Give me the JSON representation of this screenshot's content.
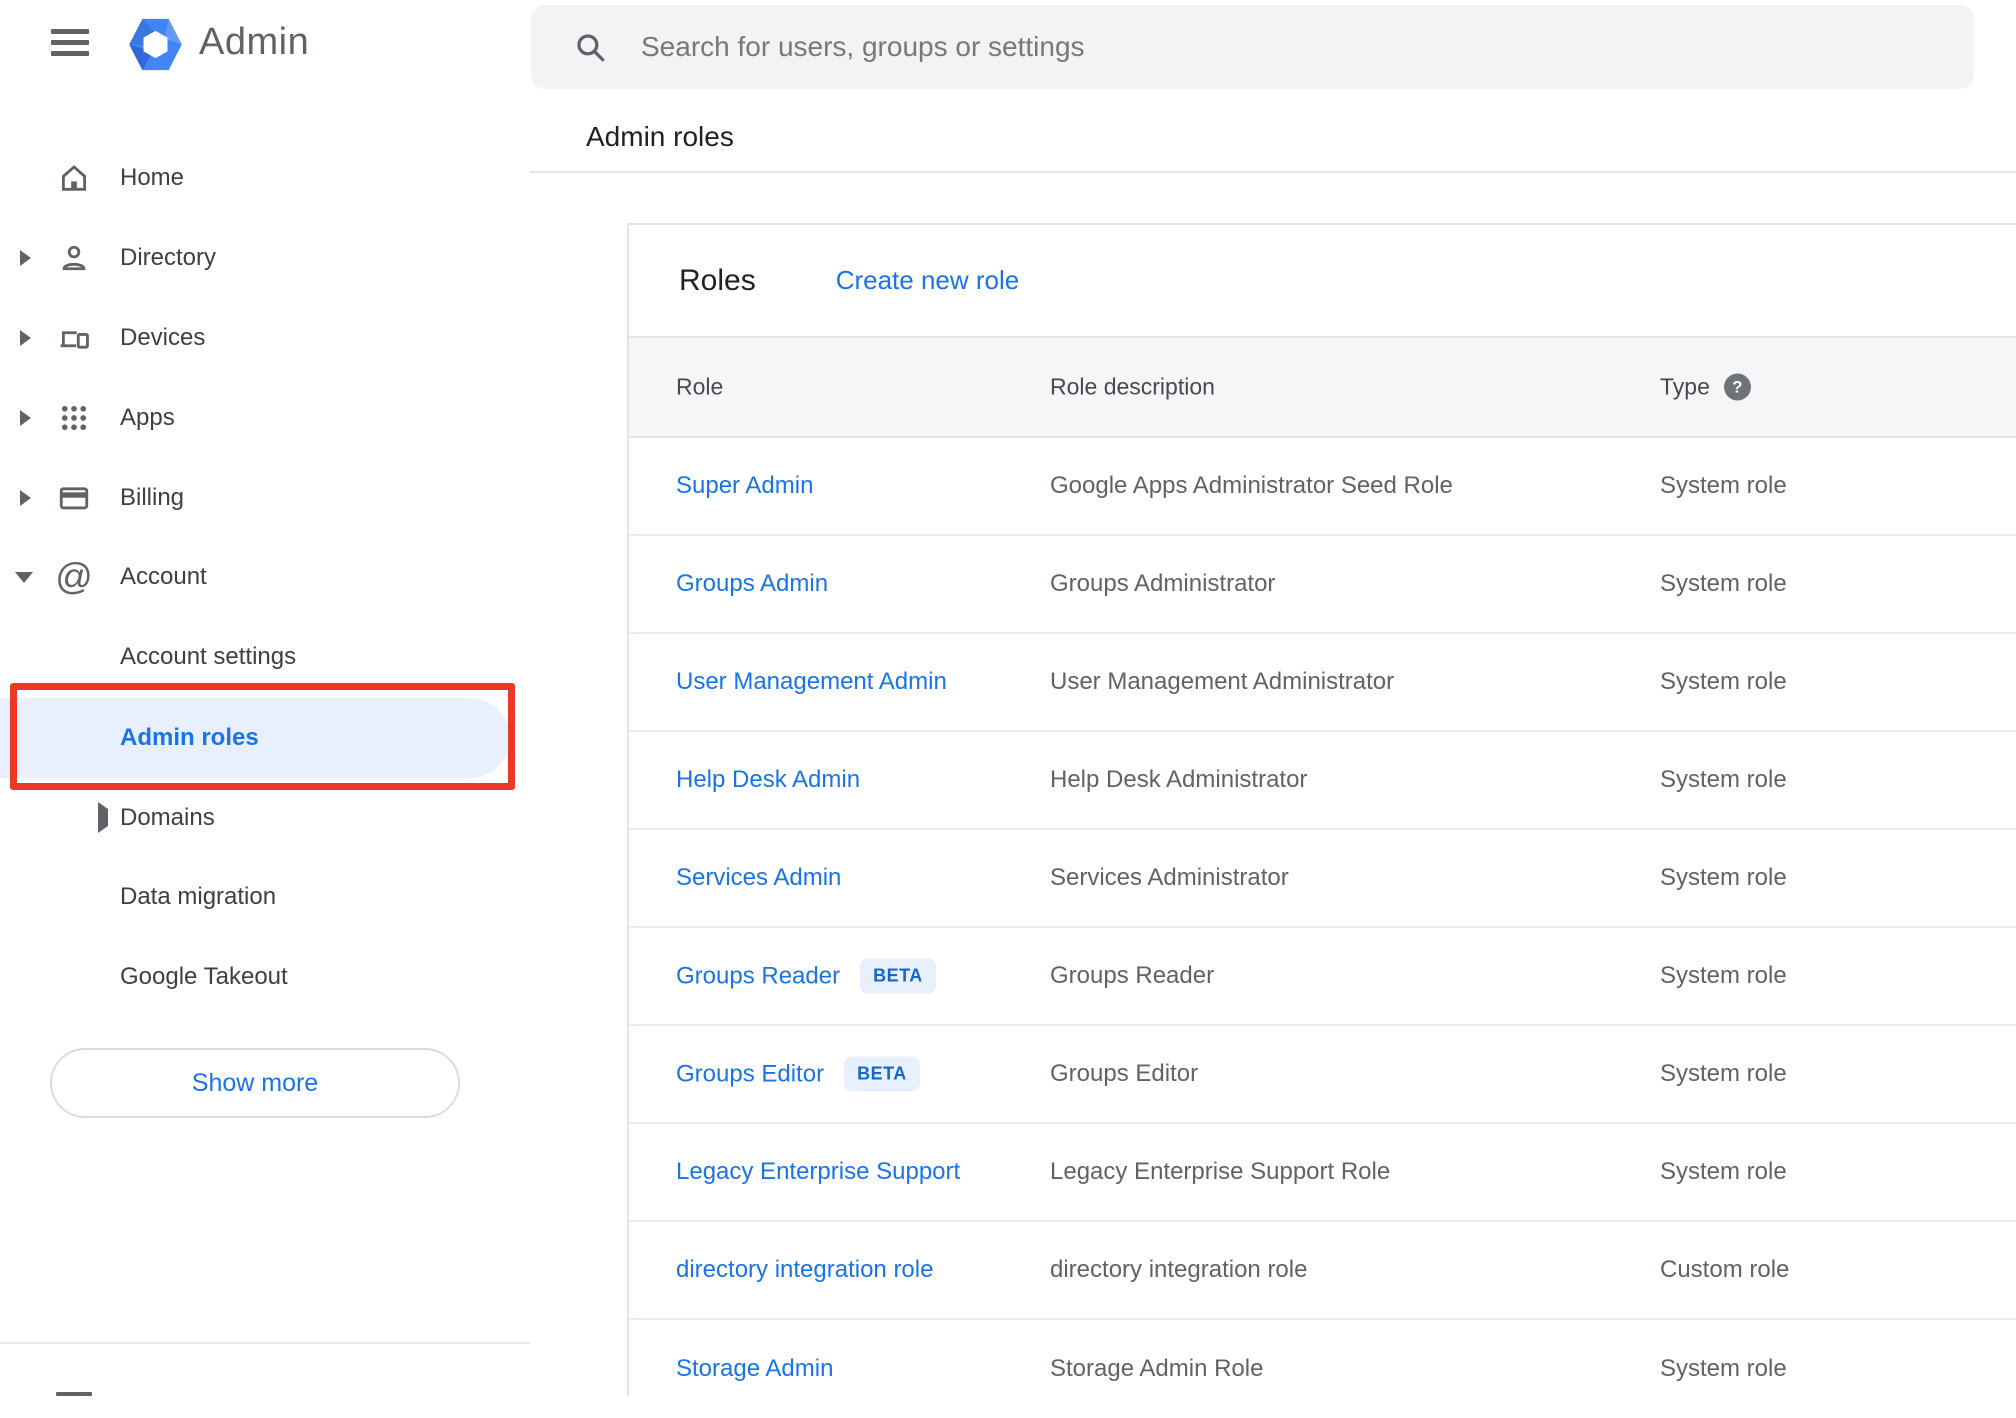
{
  "app": {
    "brand": "Admin"
  },
  "search": {
    "placeholder": "Search for users, groups or settings"
  },
  "page": {
    "title": "Admin roles"
  },
  "sidebar": {
    "items": [
      {
        "label": "Home",
        "icon": "home-icon",
        "expandable": false
      },
      {
        "label": "Directory",
        "icon": "person-icon",
        "expandable": true
      },
      {
        "label": "Devices",
        "icon": "devices-icon",
        "expandable": true
      },
      {
        "label": "Apps",
        "icon": "apps-grid-icon",
        "expandable": true
      },
      {
        "label": "Billing",
        "icon": "credit-card-icon",
        "expandable": true
      },
      {
        "label": "Account",
        "icon": "at-sign-icon",
        "expandable": true,
        "expanded": true
      }
    ],
    "account_children": [
      {
        "label": "Account settings"
      },
      {
        "label": "Admin roles",
        "selected": true,
        "annotated": true
      },
      {
        "label": "Domains",
        "expandable": true
      },
      {
        "label": "Data migration"
      },
      {
        "label": "Google Takeout"
      }
    ],
    "show_more": "Show more"
  },
  "main": {
    "card_title": "Roles",
    "create_link": "Create new role",
    "table": {
      "columns": [
        "Role",
        "Role description",
        "Type"
      ],
      "help_glyph": "?",
      "rows": [
        {
          "role": "Super Admin",
          "description": "Google Apps Administrator Seed Role",
          "type": "System role"
        },
        {
          "role": "Groups Admin",
          "description": "Groups Administrator",
          "type": "System role"
        },
        {
          "role": "User Management Admin",
          "description": "User Management Administrator",
          "type": "System role"
        },
        {
          "role": "Help Desk Admin",
          "description": "Help Desk Administrator",
          "type": "System role"
        },
        {
          "role": "Services Admin",
          "description": "Services Administrator",
          "type": "System role"
        },
        {
          "role": "Groups Reader",
          "beta": "BETA",
          "description": "Groups Reader",
          "type": "System role"
        },
        {
          "role": "Groups Editor",
          "beta": "BETA",
          "description": "Groups Editor",
          "type": "System role"
        },
        {
          "role": "Legacy Enterprise Support",
          "description": "Legacy Enterprise Support Role",
          "type": "System role"
        },
        {
          "role": "directory integration role",
          "description": "directory integration role",
          "type": "Custom role"
        },
        {
          "role": "Storage Admin",
          "description": "Storage Admin Role",
          "type": "System role"
        }
      ]
    }
  },
  "icons": {
    "menu": "hamburger three bars",
    "search": "magnifier",
    "help": "?",
    "expand-right": "▸",
    "expand-down": "▾"
  },
  "colors": {
    "accent_blue": "#1a73e8",
    "annotation_red": "#ea3a23",
    "selected_pill_bg": "#e8f0fe",
    "beta_badge_bg": "#e8f0fe",
    "beta_badge_text": "#1766c9",
    "table_header_bg": "#f5f6f7",
    "searchbar_bg": "#f1f3f4",
    "icon_gray": "#5f6368",
    "text_dark": "#202124",
    "text_gray": "#5f6368",
    "logo_blue": "#4285f4"
  }
}
